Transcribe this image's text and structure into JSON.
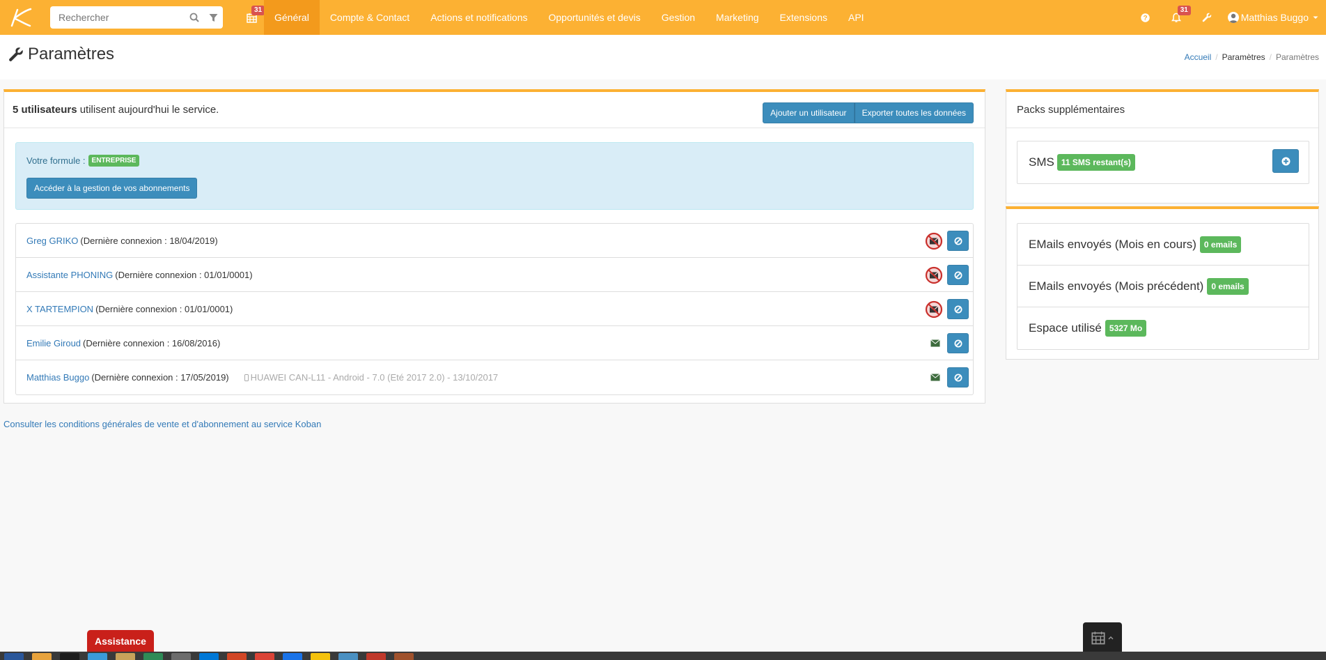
{
  "nav": {
    "search_placeholder": "Rechercher",
    "calendar_badge": "31",
    "menu": [
      {
        "label": "Général",
        "active": true
      },
      {
        "label": "Compte & Contact"
      },
      {
        "label": "Actions et notifications"
      },
      {
        "label": "Opportunités et devis"
      },
      {
        "label": "Gestion"
      },
      {
        "label": "Marketing"
      },
      {
        "label": "Extensions"
      },
      {
        "label": "API"
      }
    ],
    "notification_badge": "31",
    "user_name": "Matthias Buggo"
  },
  "header": {
    "title": "Paramètres",
    "breadcrumb": [
      "Accueil",
      "Paramètres",
      "Paramètres"
    ]
  },
  "main": {
    "users_count": "5 utilisateurs",
    "users_text": " utilisent aujourd'hui le service.",
    "add_user_label": "Ajouter un utilisateur",
    "export_label": "Exporter toutes les données",
    "formula_label": "Votre formule :",
    "formula_badge": "ENTREPRISE",
    "manage_subscriptions_label": "Accéder à la gestion de vos abonnements",
    "users": [
      {
        "name": "Greg GRIKO",
        "last": "(Dernière connexion : 18/04/2019)",
        "mail_blocked": true
      },
      {
        "name": "Assistante PHONING",
        "last": "(Dernière connexion : 01/01/0001)",
        "mail_blocked": true
      },
      {
        "name": "X TARTEMPION",
        "last": "(Dernière connexion : 01/01/0001)",
        "mail_blocked": true
      },
      {
        "name": "Emilie Giroud",
        "last": "(Dernière connexion : 16/08/2016)",
        "mail_blocked": false
      },
      {
        "name": "Matthias Buggo",
        "last": "(Dernière connexion : 17/05/2019)",
        "mail_blocked": false,
        "device": "HUAWEI CAN-L11 - Android - 7.0 (Eté 2017 2.0) - 13/10/2017"
      }
    ],
    "cgv_link": "Consulter les conditions générales de vente et d'abonnement au service Koban"
  },
  "packs": {
    "title": "Packs supplémentaires",
    "sms_label": "SMS",
    "sms_badge": "11 SMS restant(s)"
  },
  "stats": {
    "rows": [
      {
        "label": "EMails envoyés (Mois en cours)",
        "badge": "0 emails"
      },
      {
        "label": "EMails envoyés (Mois précédent)",
        "badge": "0 emails"
      },
      {
        "label": "Espace utilisé",
        "badge": "5327 Mo"
      }
    ]
  },
  "footer": {
    "assistance_label": "Assistance"
  },
  "colors": {
    "navbar": "#fcb133",
    "active_menu": "#f39a1c",
    "primary_button": "#3c8dbc",
    "success_label": "#5cb85c",
    "assistance": "#c9201a"
  }
}
